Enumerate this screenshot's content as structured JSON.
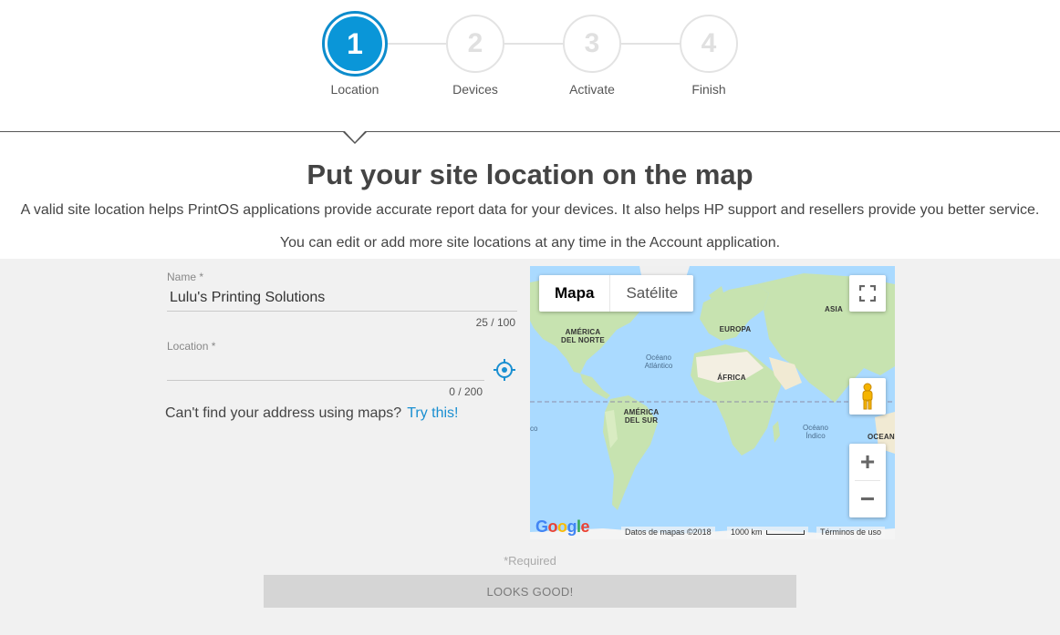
{
  "stepper": {
    "steps": [
      {
        "number": "1",
        "label": "Location",
        "state": "active"
      },
      {
        "number": "2",
        "label": "Devices",
        "state": "inactive"
      },
      {
        "number": "3",
        "label": "Activate",
        "state": "inactive"
      },
      {
        "number": "4",
        "label": "Finish",
        "state": "inactive"
      }
    ]
  },
  "page": {
    "title": "Put your site location on the map",
    "description": "A valid site location helps PrintOS applications provide accurate report data for your devices. It also helps HP support and resellers provide you better service.",
    "note": "You can edit or add more site locations at any time in the Account application."
  },
  "form": {
    "name_label": "Name",
    "name_value": "Lulu's Printing Solutions",
    "name_counter": "25 / 100",
    "location_label": "Location",
    "location_value": "",
    "location_counter": "0 / 200",
    "required_mark": "*",
    "help_text": "Can't find your address using maps?",
    "help_link": "Try this!",
    "required_note": "*Required",
    "submit_label": "LOOKS GOOD!"
  },
  "map": {
    "type_options": [
      "Mapa",
      "Satélite"
    ],
    "selected_type": "Mapa",
    "labels": {
      "north_america": "AMÉRICA\nDEL NORTE",
      "europe": "EUROPA",
      "asia": "ASIA",
      "africa": "ÁFRICA",
      "south_america": "AMÉRICA\nDEL SUR",
      "atlantic": "Océano\nAtlántico",
      "indian": "Océano\nÍndico",
      "oceania": "OCEAN",
      "edge": "co"
    },
    "google_logo": "Google",
    "data_attribution": "Datos de mapas ©2018",
    "scale": "1000 km",
    "terms": "Términos de uso",
    "colors": {
      "water": "#aadaff",
      "land": "#c7e3b0",
      "desert": "#f3efe2"
    }
  },
  "colors": {
    "accent": "#0a96d8",
    "link": "#1a8fd1",
    "panel": "#f1f1f1",
    "button_disabled": "#d5d5d5"
  }
}
